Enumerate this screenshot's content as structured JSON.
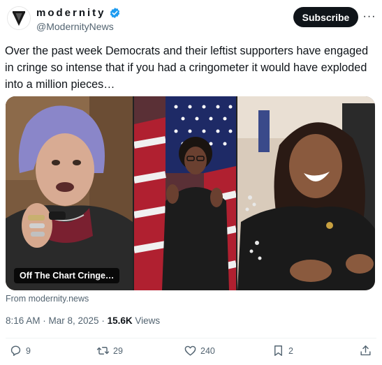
{
  "account": {
    "display_name": "modernity",
    "handle": "@ModernityNews",
    "verified_badge": "verified-check-icon",
    "subscribe_label": "Subscribe",
    "more_label": "···"
  },
  "post": {
    "text": "Over the past week Democrats and their leftist supporters have engaged in cringe so intense that if you had a cringometer it would have exploded into a million pieces…",
    "video_caption": "Off The Chart Cringe…",
    "source": "From modernity.news",
    "time": "8:16 AM · Mar 8, 2025 · ",
    "views_count": "15.6K",
    "views_label": " Views"
  },
  "engagement": {
    "replies": "9",
    "reposts": "29",
    "likes": "240",
    "bookmarks": "2"
  },
  "colors": {
    "text_primary": "#0f1419",
    "text_secondary": "#536471",
    "verified_blue": "#1d9bf0",
    "divider": "#eff3f4"
  }
}
